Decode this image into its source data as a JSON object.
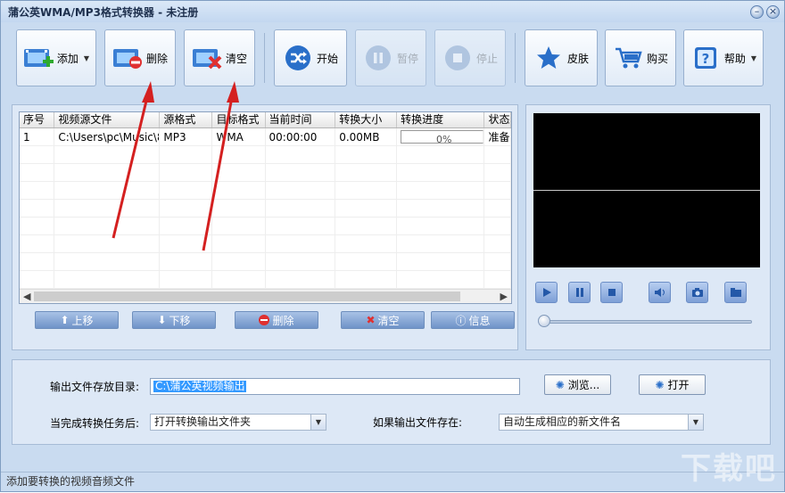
{
  "window": {
    "title": "蒲公英WMA/MP3格式转换器 - 未注册"
  },
  "toolbar": {
    "add": "添加",
    "delete": "删除",
    "clear": "清空",
    "start": "开始",
    "pause": "暂停",
    "stop": "停止",
    "skin": "皮肤",
    "buy": "购买",
    "help": "帮助"
  },
  "table": {
    "columns": [
      "序号",
      "视频源文件",
      "源格式",
      "目标格式",
      "当前时间",
      "转换大小",
      "转换进度",
      "状态"
    ],
    "rows": [
      {
        "index": "1",
        "source": "C:\\Users\\pc\\Music\\8...",
        "src_format": "MP3",
        "dst_format": "WMA",
        "time": "00:00:00",
        "size": "0.00MB",
        "progress": "0%",
        "status": "准备"
      }
    ]
  },
  "list_buttons": {
    "up": "上移",
    "down": "下移",
    "delete": "删除",
    "clear": "清空",
    "info": "信息"
  },
  "output": {
    "dir_label": "输出文件存放目录:",
    "dir_value": "C:\\蒲公英视频输出",
    "browse": "浏览...",
    "open": "打开",
    "after_label": "当完成转换任务后:",
    "after_value": "打开转换输出文件夹",
    "exists_label": "如果输出文件存在:",
    "exists_value": "自动生成相应的新文件名"
  },
  "statusbar": {
    "text": "添加要转换的视频音频文件"
  },
  "watermark": "下载吧",
  "colors": {
    "accent": "#2a6fc9",
    "delete_red": "#e03030",
    "arrow_red": "#d42020"
  }
}
